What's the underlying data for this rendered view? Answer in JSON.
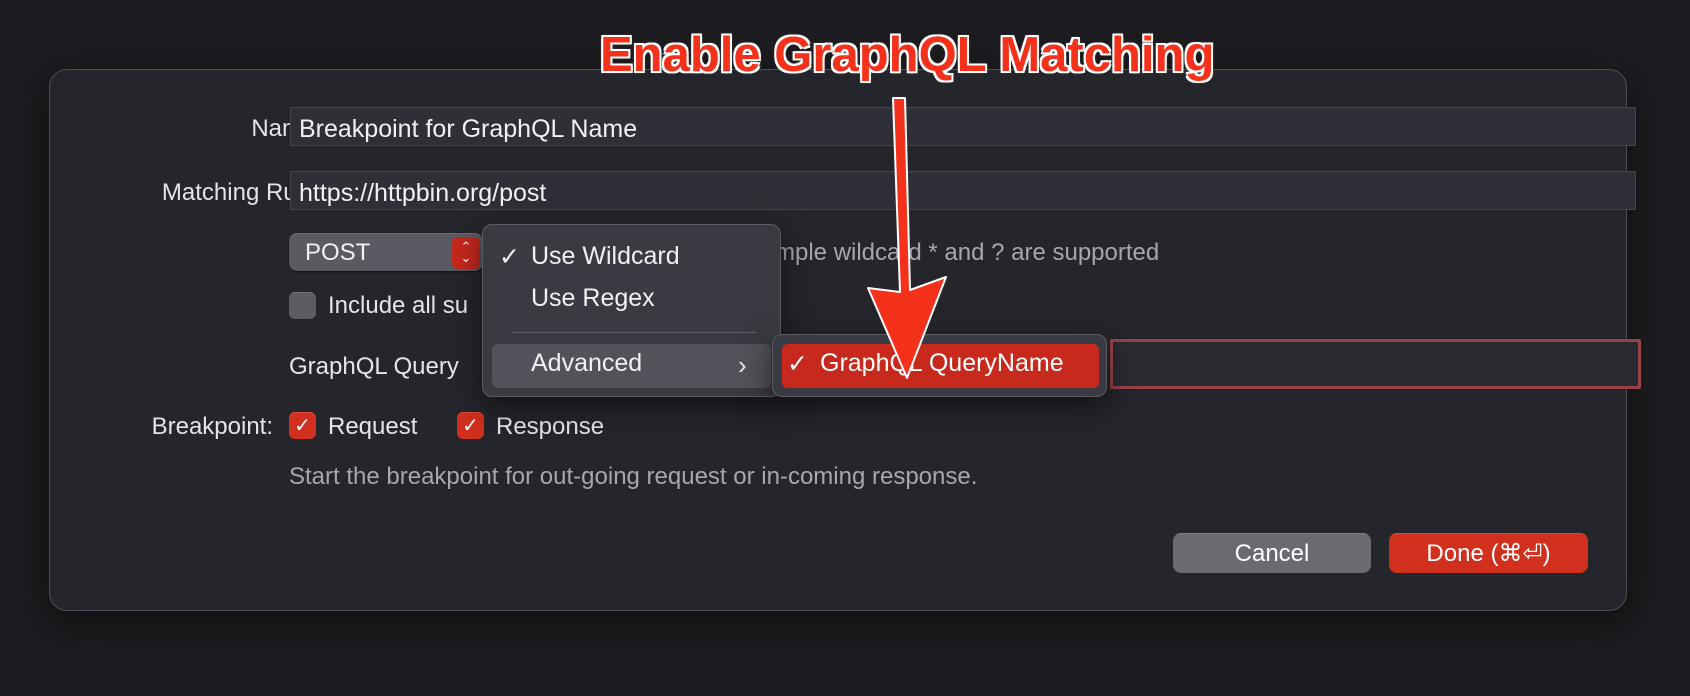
{
  "annotation": {
    "title": "Enable GraphQL Matching",
    "color": "#f4321c"
  },
  "form": {
    "name_label": "Name:",
    "name_value": "Breakpoint for GraphQL Name",
    "matching_label": "Matching Rule:",
    "matching_value": "https://httpbin.org/post",
    "method_value": "POST",
    "wildcard_hint_visible": "mple wildcard * and ? are supported",
    "include_subpaths_visible": "Include all su",
    "graphql_label_visible": "GraphQL Query",
    "breakpoint_label": "Breakpoint:",
    "request_label": "Request",
    "response_label": "Response",
    "breakpoint_hint": "Start the breakpoint for out-going request or in-coming response."
  },
  "buttons": {
    "cancel": "Cancel",
    "done": "Done (⌘⏎)"
  },
  "menu": {
    "items": [
      {
        "label": "Use Wildcard",
        "checked": true
      },
      {
        "label": "Use Regex",
        "checked": false
      },
      {
        "label": "Advanced",
        "submenu": true
      }
    ],
    "submenu": [
      {
        "label": "GraphQL QueryName",
        "checked": true
      }
    ]
  },
  "colors": {
    "accent": "#d2301f",
    "background": "#1d1c20",
    "sheet": "#25262c"
  }
}
